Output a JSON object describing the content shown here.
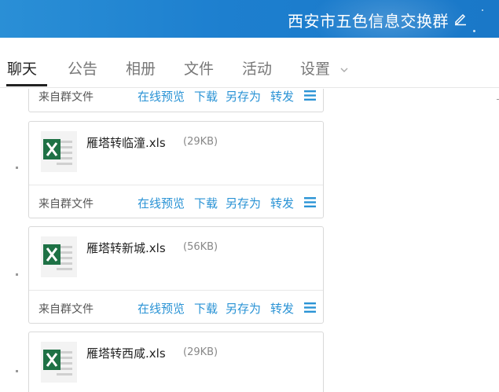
{
  "window": {
    "group_name": "西安市五色信息交换群"
  },
  "tabs": [
    {
      "label": "聊天",
      "active": true
    },
    {
      "label": "公告"
    },
    {
      "label": "相册"
    },
    {
      "label": "文件"
    },
    {
      "label": "活动"
    },
    {
      "label": "设置"
    }
  ],
  "actions": {
    "preview": "在线预览",
    "download": "下载",
    "save_as": "另存为",
    "forward": "转发"
  },
  "file_source": "来自群文件",
  "files": [
    {
      "name": "雁塔转临潼.xls",
      "size": "(29KB)"
    },
    {
      "name": "雁塔转新城.xls",
      "size": "(56KB)"
    },
    {
      "name": "雁塔转西咸.xls",
      "size": "(29KB)"
    }
  ],
  "colors": {
    "titlebar": "#1d7fcf",
    "link": "#2a93d5",
    "excel_green": "#1e7145"
  }
}
